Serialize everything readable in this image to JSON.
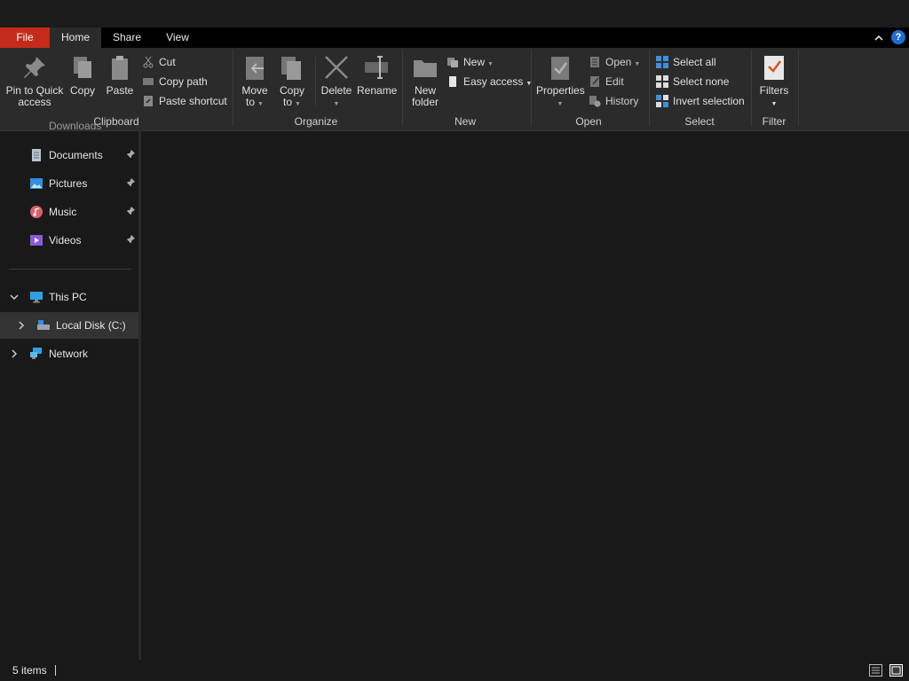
{
  "tabs": {
    "file": "File",
    "home": "Home",
    "share": "Share",
    "view": "View"
  },
  "help_label": "?",
  "ribbon": {
    "clipboard": {
      "label": "Clipboard",
      "pin_line1": "Pin to Quick",
      "pin_line2": "access",
      "copy": "Copy",
      "paste": "Paste",
      "cut": "Cut",
      "copy_path": "Copy path",
      "paste_shortcut": "Paste shortcut"
    },
    "organize": {
      "label": "Organize",
      "move_line1": "Move",
      "move_line2": "to",
      "copy_line1": "Copy",
      "copy_line2": "to",
      "delete": "Delete",
      "rename": "Rename"
    },
    "new": {
      "label": "New",
      "folder_line1": "New",
      "folder_line2": "folder",
      "new_item": "New",
      "easy_access": "Easy access"
    },
    "open": {
      "label": "Open",
      "properties": "Properties",
      "open": "Open",
      "edit": "Edit",
      "history": "History"
    },
    "select": {
      "label": "Select",
      "select_all": "Select all",
      "select_none": "Select none",
      "invert": "Invert selection"
    },
    "filter": {
      "label": "Filter",
      "filters": "Filters"
    }
  },
  "nav": {
    "partial": "Downloads",
    "documents": "Documents",
    "pictures": "Pictures",
    "music": "Music",
    "videos": "Videos",
    "this_pc": "This PC",
    "local_disk": "Local Disk (C:)",
    "network": "Network"
  },
  "status": {
    "items": "5 items"
  },
  "colors": {
    "file_tab": "#c42b1c",
    "accent": "#1f6fd1",
    "background": "#191919",
    "ribbon": "#2b2b2b"
  }
}
